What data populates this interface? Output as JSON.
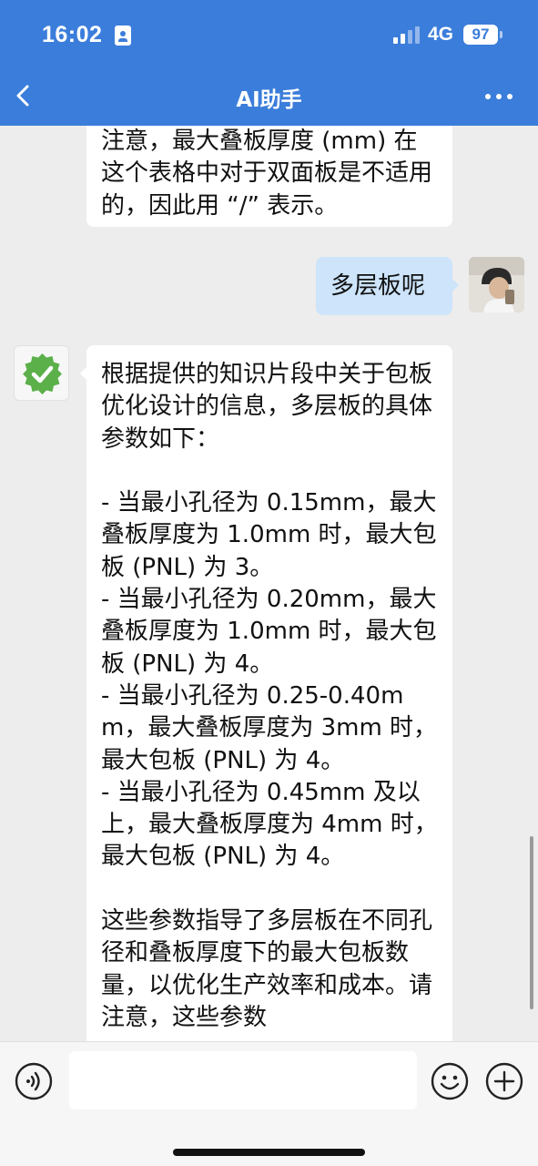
{
  "status_bar": {
    "time": "16:02",
    "network": "4G",
    "battery": "97"
  },
  "nav": {
    "title": "AI助手",
    "back_icon": "chevron-left-icon",
    "more_icon": "more-horizontal-icon"
  },
  "messages": {
    "previous_bot": "注意，最大叠板厚度 (mm) 在这个表格中对于双面板是不适用的，因此用 “/” 表示。",
    "user": "多层板呢",
    "bot_reply": "根据提供的知识片段中关于包板优化设计的信息，多层板的具体参数如下：\n\n- 当最小孔径为 0.15mm，最大叠板厚度为 1.0mm 时，最大包板 (PNL) 为 3。\n- 当最小孔径为 0.20mm，最大叠板厚度为 1.0mm 时，最大包板 (PNL) 为 4。\n- 当最小孔径为 0.25-0.40mm，最大叠板厚度为 3mm 时，最大包板 (PNL) 为 4。\n- 当最小孔径为 0.45mm 及以上，最大叠板厚度为 4mm 时，最大包板 (PNL) 为 4。\n\n这些参数指导了多层板在不同孔径和叠板厚度下的最大包板数量，以优化生产效率和成本。请注意，这些参数"
  },
  "input_bar": {
    "placeholder": "",
    "voice_icon": "voice-input-icon",
    "emoji_icon": "emoji-icon",
    "plus_icon": "plus-circle-icon"
  },
  "colors": {
    "header": "#3b7ddb",
    "user_bubble": "#cde4fb",
    "bot_badge": "#5bb04a"
  }
}
